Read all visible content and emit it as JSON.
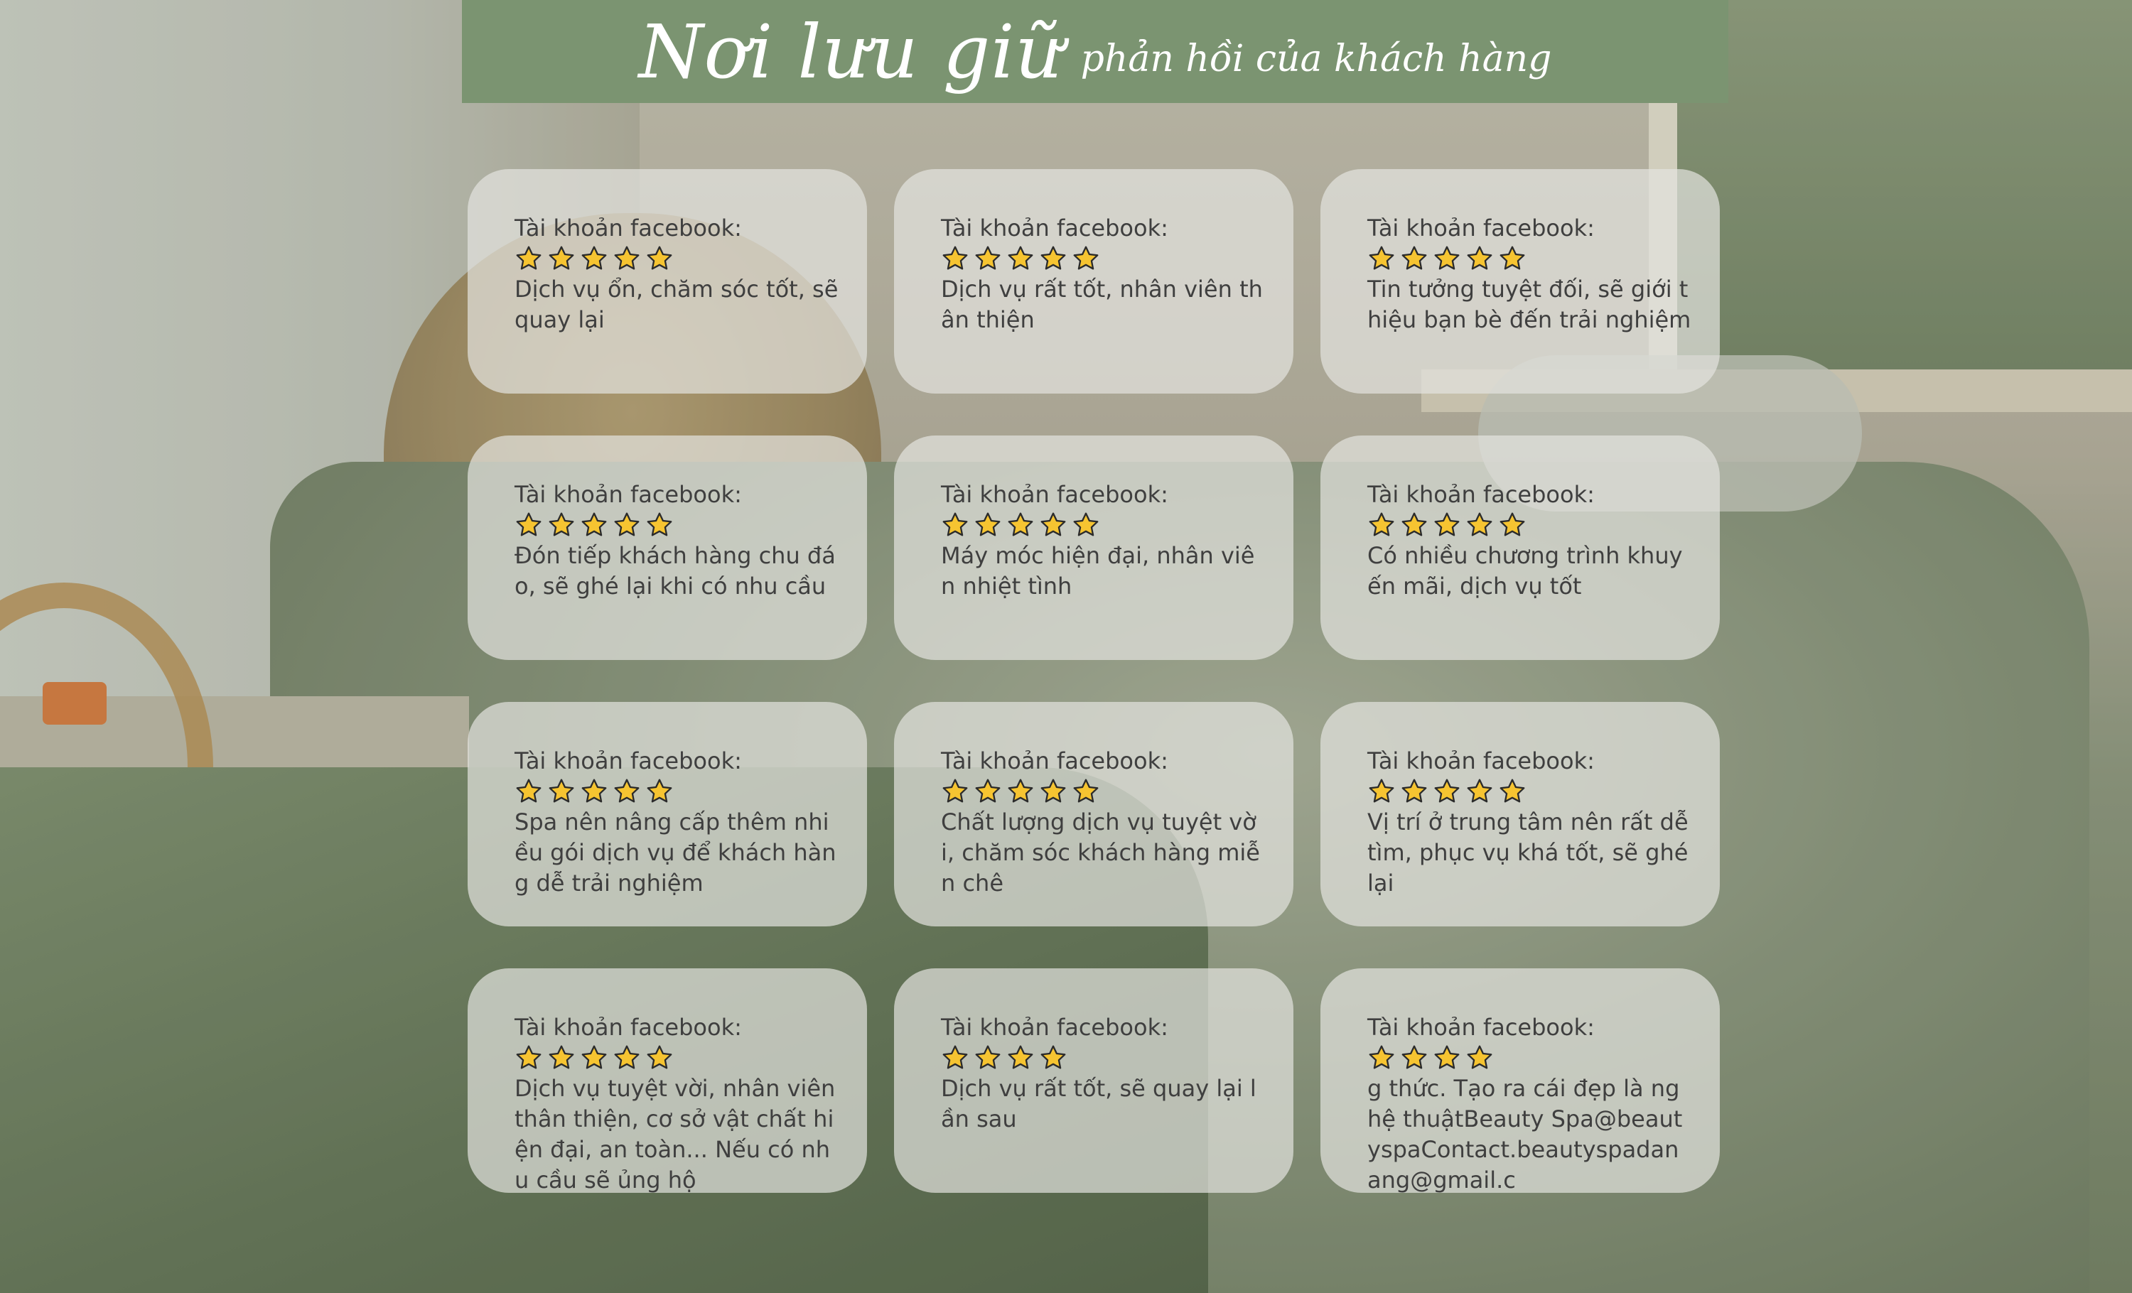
{
  "header": {
    "title_main": "Nơi lưu giữ",
    "title_sub": "phản hồi của khách hàng"
  },
  "colors": {
    "header_bg": "#7b9471",
    "card_bg": "#e4e4e0",
    "star_fill": "#f6c431",
    "star_stroke": "#2b2b2b"
  },
  "reviews": [
    {
      "account_label": "Tài khoản facebook:",
      "rating": 5,
      "text": "Dịch vụ ổn, chăm sóc tốt, sẽ quay lại"
    },
    {
      "account_label": "Tài khoản facebook:",
      "rating": 5,
      "text": "Dịch vụ rất tốt, nhân viên thân thiện"
    },
    {
      "account_label": "Tài khoản facebook:",
      "rating": 5,
      "text": "Tin tưởng tuyệt đối, sẽ giới thiệu bạn bè đến trải nghiệm"
    },
    {
      "account_label": "Tài khoản facebook:",
      "rating": 5,
      "text": "Đón tiếp khách hàng chu đáo, sẽ ghé lại khi có nhu cầu"
    },
    {
      "account_label": "Tài khoản facebook:",
      "rating": 5,
      "text": "Máy móc hiện đại, nhân viên nhiệt tình"
    },
    {
      "account_label": "Tài khoản facebook:",
      "rating": 5,
      "text": "Có nhiều chương trình khuyến mãi, dịch vụ tốt"
    },
    {
      "account_label": "Tài khoản facebook:",
      "rating": 5,
      "text": "Spa nên nâng cấp thêm nhiều gói dịch vụ để khách hàng dễ trải nghiệm"
    },
    {
      "account_label": "Tài khoản facebook:",
      "rating": 5,
      "text": "Chất lượng dịch vụ tuyệt vời, chăm sóc khách hàng miễn chê"
    },
    {
      "account_label": "Tài khoản facebook:",
      "rating": 5,
      "text": "Vị trí ở trung tâm nên rất dễ tìm, phục vụ khá tốt, sẽ ghé lại"
    },
    {
      "account_label": "Tài khoản facebook:",
      "rating": 5,
      "text": "Dịch vụ tuyệt vời, nhân viên thân thiện, cơ sở vật chất hiện đại, an toàn... Nếu có nhu cầu sẽ ủng hộ"
    },
    {
      "account_label": "Tài khoản facebook:",
      "rating": 4,
      "text": "Dịch vụ rất tốt, sẽ quay lại lần sau"
    },
    {
      "account_label": "Tài khoản facebook:",
      "rating": 4,
      "text": "g thức. Tạo ra cái đẹp là nghệ thuậtBeauty Spa@beautyspaContact.beautyspadanang@gmail.c"
    }
  ]
}
